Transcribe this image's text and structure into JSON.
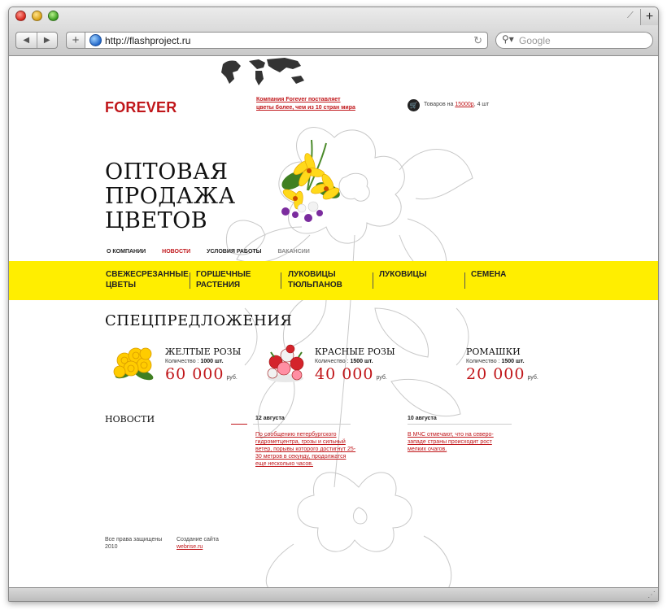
{
  "browser": {
    "url": "http://flashproject.ru",
    "search_placeholder": "Google",
    "back_label": "◀",
    "forward_label": "▶",
    "add_label": "+",
    "new_tab_label": "+"
  },
  "header": {
    "logo": "FOREVER",
    "tagline": "Компания Forever поставляет цветы более, чем из 10 стран мира",
    "cart_prefix": "Товаров на",
    "cart_sum": "15000р",
    "cart_suffix": ", 4 шт"
  },
  "hero": {
    "lines": [
      "ОПТОВАЯ",
      "ПРОДАЖА",
      "ЦВЕТОВ"
    ]
  },
  "topnav": {
    "items": [
      "О КОМПАНИИ",
      "НОВОСТИ",
      "УСЛОВИЯ РАБОТЫ",
      "ВАКАНСИИ"
    ]
  },
  "categories": [
    {
      "line1": "СВЕЖЕСРЕЗАННЫЕ",
      "line2": "ЦВЕТЫ"
    },
    {
      "line1": "ГОРШЕЧНЫЕ",
      "line2": "РАСТЕНИЯ"
    },
    {
      "line1": "ЛУКОВИЦЫ",
      "line2": "ТЮЛЬПАНОВ"
    },
    {
      "line1": "ЛУКОВИЦЫ",
      "line2": ""
    },
    {
      "line1": "СЕМЕНА",
      "line2": ""
    }
  ],
  "specials": {
    "title": "СПЕЦПРЕДЛОЖЕНИЯ",
    "qty_label": "Количество :",
    "currency": "руб.",
    "items": [
      {
        "name": "ЖЕЛТЫЕ РОЗЫ",
        "qty": "1000 шт.",
        "price": "60 000"
      },
      {
        "name": "КРАСНЫЕ РОЗЫ",
        "qty": "1500 шт.",
        "price": "40 000"
      },
      {
        "name": "РОМАШКИ",
        "qty": "1500 шт.",
        "price": "20 000"
      }
    ]
  },
  "news": {
    "title": "НОВОСТИ",
    "items": [
      {
        "date": "12 августа",
        "text": "По сообщению петербургского гидрометцентра, грозы и сильный ветер, порывы которого достигнут 25-30 метров в секунду, продолжатся еще несколько часов."
      },
      {
        "date": "10 августа",
        "text": "В МЧС отмечают, что на северо-западе страны происходит рост мелких очагов."
      }
    ]
  },
  "footer": {
    "rights": "Все права защищены 2010",
    "made_label": "Создание сайта",
    "made_link": "webrise.ru"
  },
  "colors": {
    "brand_red": "#c0161a",
    "category_bar": "#ffee00"
  }
}
